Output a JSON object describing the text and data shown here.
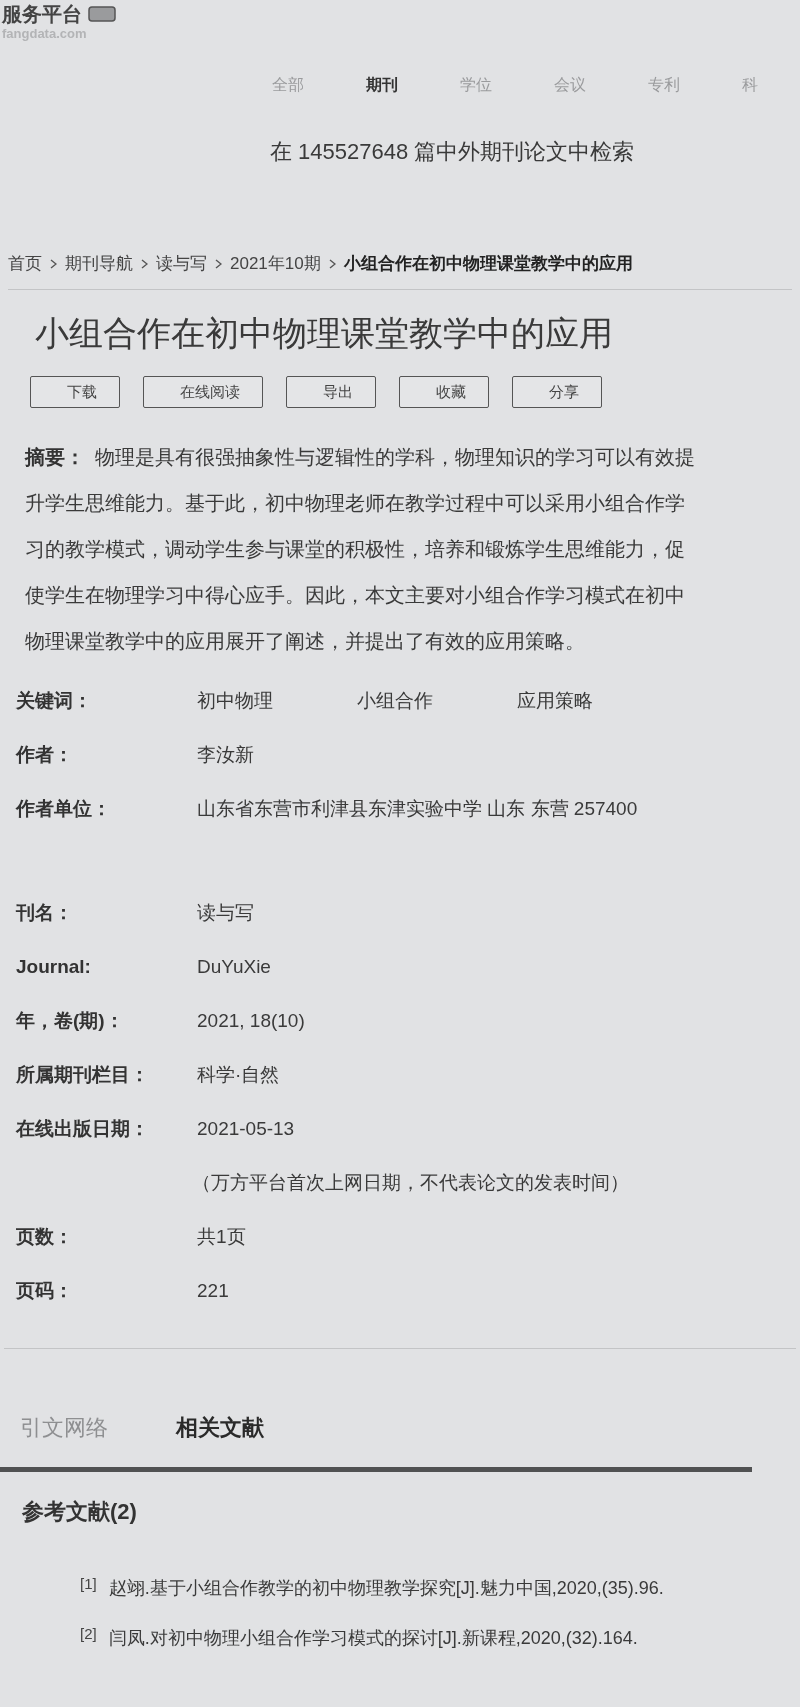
{
  "logo": {
    "name": "服务平台",
    "domain": "fangdata.com"
  },
  "nav_tabs": [
    {
      "label": "全部",
      "selected": false
    },
    {
      "label": "期刊",
      "selected": true
    },
    {
      "label": "学位",
      "selected": false
    },
    {
      "label": "会议",
      "selected": false
    },
    {
      "label": "专利",
      "selected": false
    },
    {
      "label": "科",
      "selected": false
    }
  ],
  "search": {
    "placeholder": "在 145527648 篇中外期刊论文中检索"
  },
  "breadcrumb": [
    {
      "label": "首页",
      "current": false
    },
    {
      "label": "期刊导航",
      "current": false
    },
    {
      "label": "读与写",
      "current": false
    },
    {
      "label": "2021年10期",
      "current": false
    },
    {
      "label": "小组合作在初中物理课堂教学中的应用",
      "current": true
    }
  ],
  "article": {
    "title": "小组合作在初中物理课堂教学中的应用",
    "actions": [
      "下载",
      "在线阅读",
      "导出",
      "收藏",
      "分享"
    ],
    "abstract": {
      "label": "摘要：",
      "text": "物理是具有很强抽象性与逻辑性的学科，物理知识的学习可以有效提升学生思维能力。基于此，初中物理老师在教学过程中可以采用小组合作学习的教学模式，调动学生参与课堂的积极性，培养和锻炼学生思维能力，促使学生在物理学习中得心应手。因此，本文主要对小组合作学习模式在初中物理课堂教学中的应用展开了阐述，并提出了有效的应用策略。"
    }
  },
  "author_info": [
    {
      "label": "关键词：",
      "values": [
        "初中物理",
        "小组合作",
        "应用策略"
      ]
    },
    {
      "label": "作者：",
      "values": [
        "李汝新"
      ]
    },
    {
      "label": "作者单位：",
      "values": [
        "山东省东营市利津县东津实验中学 山东 东营 257400"
      ]
    }
  ],
  "publication_info": [
    {
      "label": "刊名：",
      "values": [
        "读与写"
      ]
    },
    {
      "label": "Journal:",
      "values": [
        "DuYuXie"
      ]
    },
    {
      "label": "年，卷(期)：",
      "values": [
        "2021, 18(10)"
      ]
    },
    {
      "label": "所属期刊栏目：",
      "values": [
        "科学·自然"
      ]
    },
    {
      "label": "在线出版日期：",
      "values": [
        "2021-05-13"
      ],
      "note": "（万方平台首次上网日期，不代表论文的发表时间）"
    },
    {
      "label": "页数：",
      "values": [
        "共1页"
      ]
    },
    {
      "label": "页码：",
      "values": [
        "221"
      ]
    }
  ],
  "bottom_tabs": [
    {
      "label": "引文网络",
      "selected": false
    },
    {
      "label": "相关文献",
      "selected": true
    }
  ],
  "references": {
    "heading": "参考文献(2)",
    "items": [
      {
        "index": "[1]",
        "text": "赵翊.基于小组合作教学的初中物理教学探究[J].魅力中国,2020,(35).96."
      },
      {
        "index": "[2]",
        "text": "闫凤.对初中物理小组合作学习模式的探讨[J].新课程,2020,(32).164."
      }
    ]
  }
}
